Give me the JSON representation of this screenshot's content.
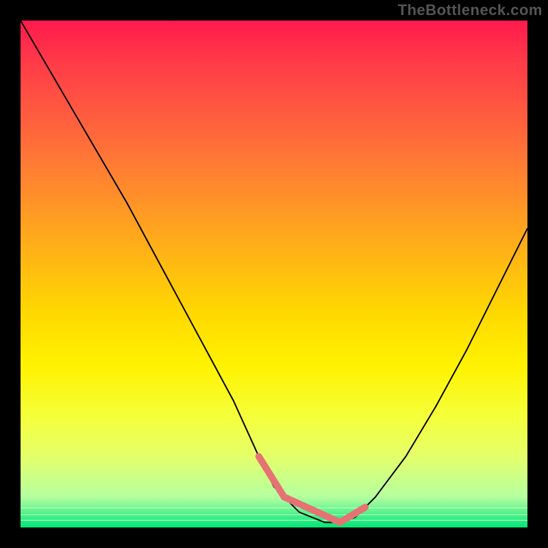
{
  "watermark": "TheBottleneck.com",
  "chart_data": {
    "type": "line",
    "title": "",
    "xlabel": "",
    "ylabel": "",
    "xlim": [
      0,
      100
    ],
    "ylim": [
      0,
      100
    ],
    "series": [
      {
        "name": "curve",
        "x": [
          0,
          7,
          14,
          21,
          28,
          35,
          42,
          47,
          50,
          55,
          60,
          63,
          66,
          70,
          76,
          82,
          88,
          94,
          100
        ],
        "y": [
          100,
          88,
          76,
          64,
          51,
          38,
          25,
          14,
          8,
          3,
          1,
          1,
          2,
          6,
          14,
          24,
          35,
          47,
          59
        ]
      }
    ],
    "markers": {
      "name": "highlight-band",
      "color": "#e57373",
      "flat_x": [
        52,
        63
      ],
      "left_tangent_x": [
        47,
        52
      ],
      "right_tangent_x": [
        63,
        68
      ]
    },
    "gradient_stops": [
      {
        "pos": 0.0,
        "color": "#ff1a4d"
      },
      {
        "pos": 0.5,
        "color": "#ffd900"
      },
      {
        "pos": 0.85,
        "color": "#e4ff6a"
      },
      {
        "pos": 1.0,
        "color": "#00e676"
      }
    ]
  }
}
